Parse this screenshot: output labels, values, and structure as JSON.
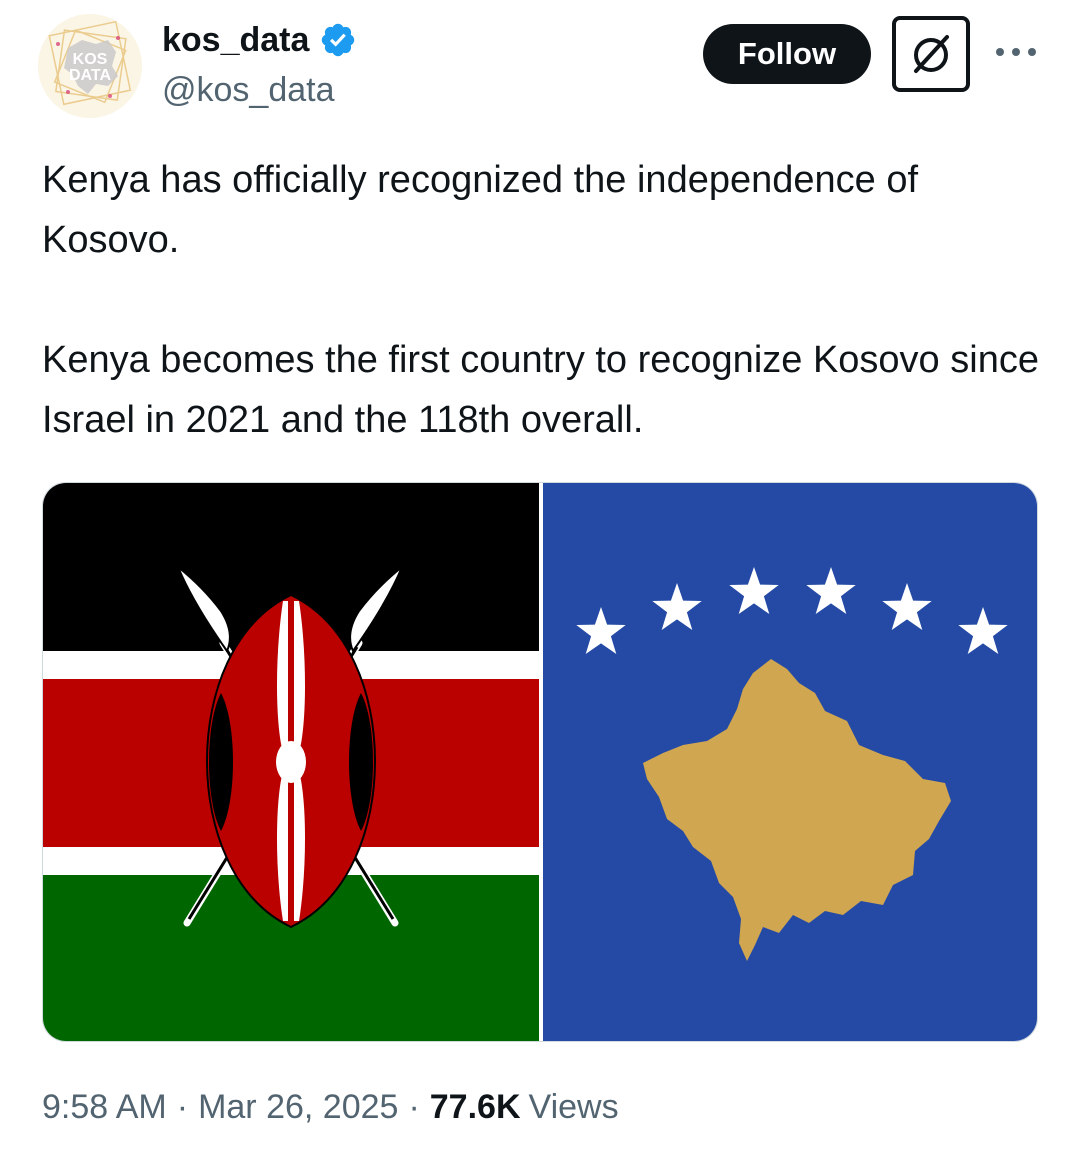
{
  "author": {
    "display_name": "kos_data",
    "handle": "@kos_data",
    "avatar_text_line1": "KOS",
    "avatar_text_line2": "DATA",
    "verified": true
  },
  "actions": {
    "follow_label": "Follow",
    "grok_icon": "grok-icon",
    "more_icon": "more-icon"
  },
  "tweet": {
    "paragraph1": "Kenya has officially recognized the independence of Kosovo.",
    "paragraph2": "Kenya becomes the first country to recognize Kosovo since Israel in 2021 and the 118th overall."
  },
  "media": {
    "left_image": "kenya-flag",
    "right_image": "kosovo-flag"
  },
  "meta": {
    "time": "9:58 AM",
    "separator": "·",
    "date": "Mar 26, 2025",
    "views_count": "77.6K",
    "views_label": "Views"
  },
  "colors": {
    "verified_blue": "#1d9bf0",
    "text_primary": "#0f1419",
    "text_secondary": "#536471",
    "kenya_black": "#000000",
    "kenya_red": "#bb0000",
    "kenya_green": "#006600",
    "kosovo_blue": "#244aa5",
    "kosovo_gold": "#d0a650"
  }
}
